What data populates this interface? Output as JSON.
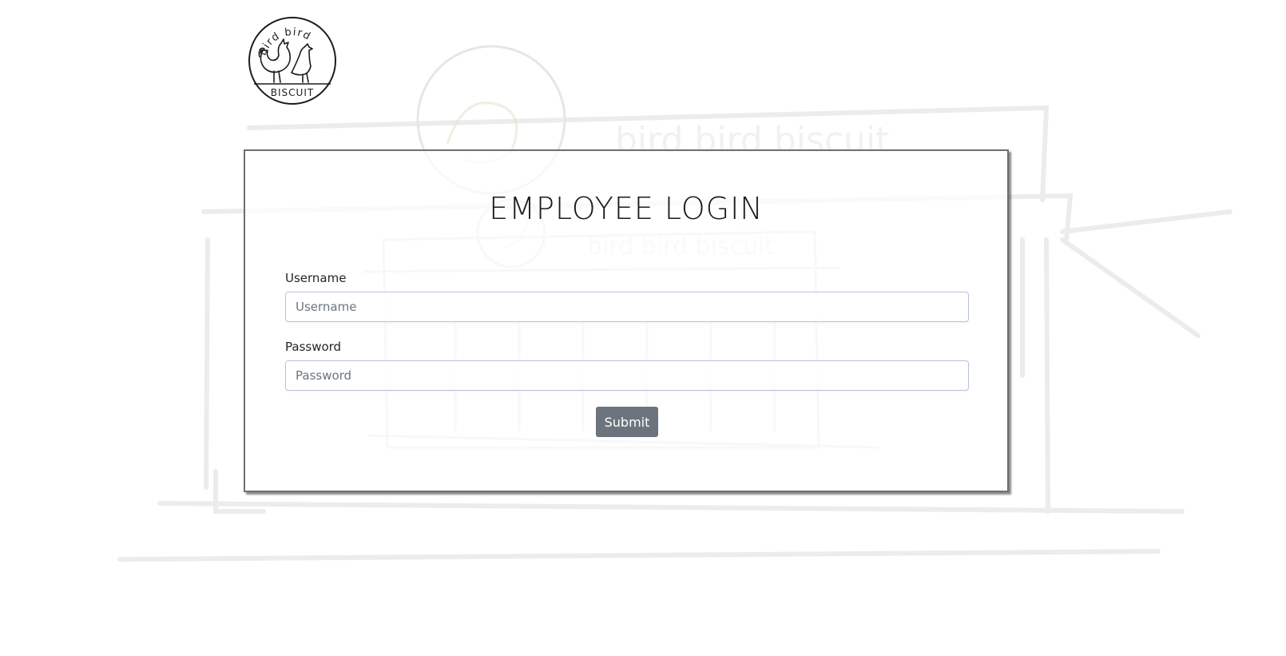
{
  "brand": {
    "logo_text_top": "bird bird",
    "logo_text_bottom": "BISCUIT"
  },
  "login": {
    "title": "EMPLOYEE LOGIN",
    "username_label": "Username",
    "username_placeholder": "Username",
    "username_value": "",
    "password_label": "Password",
    "password_placeholder": "Password",
    "password_value": "",
    "submit_label": "Submit"
  },
  "colors": {
    "submit_background": "#6c757d",
    "card_border": "#6f6f6f",
    "input_border": "#b9c1e3"
  }
}
